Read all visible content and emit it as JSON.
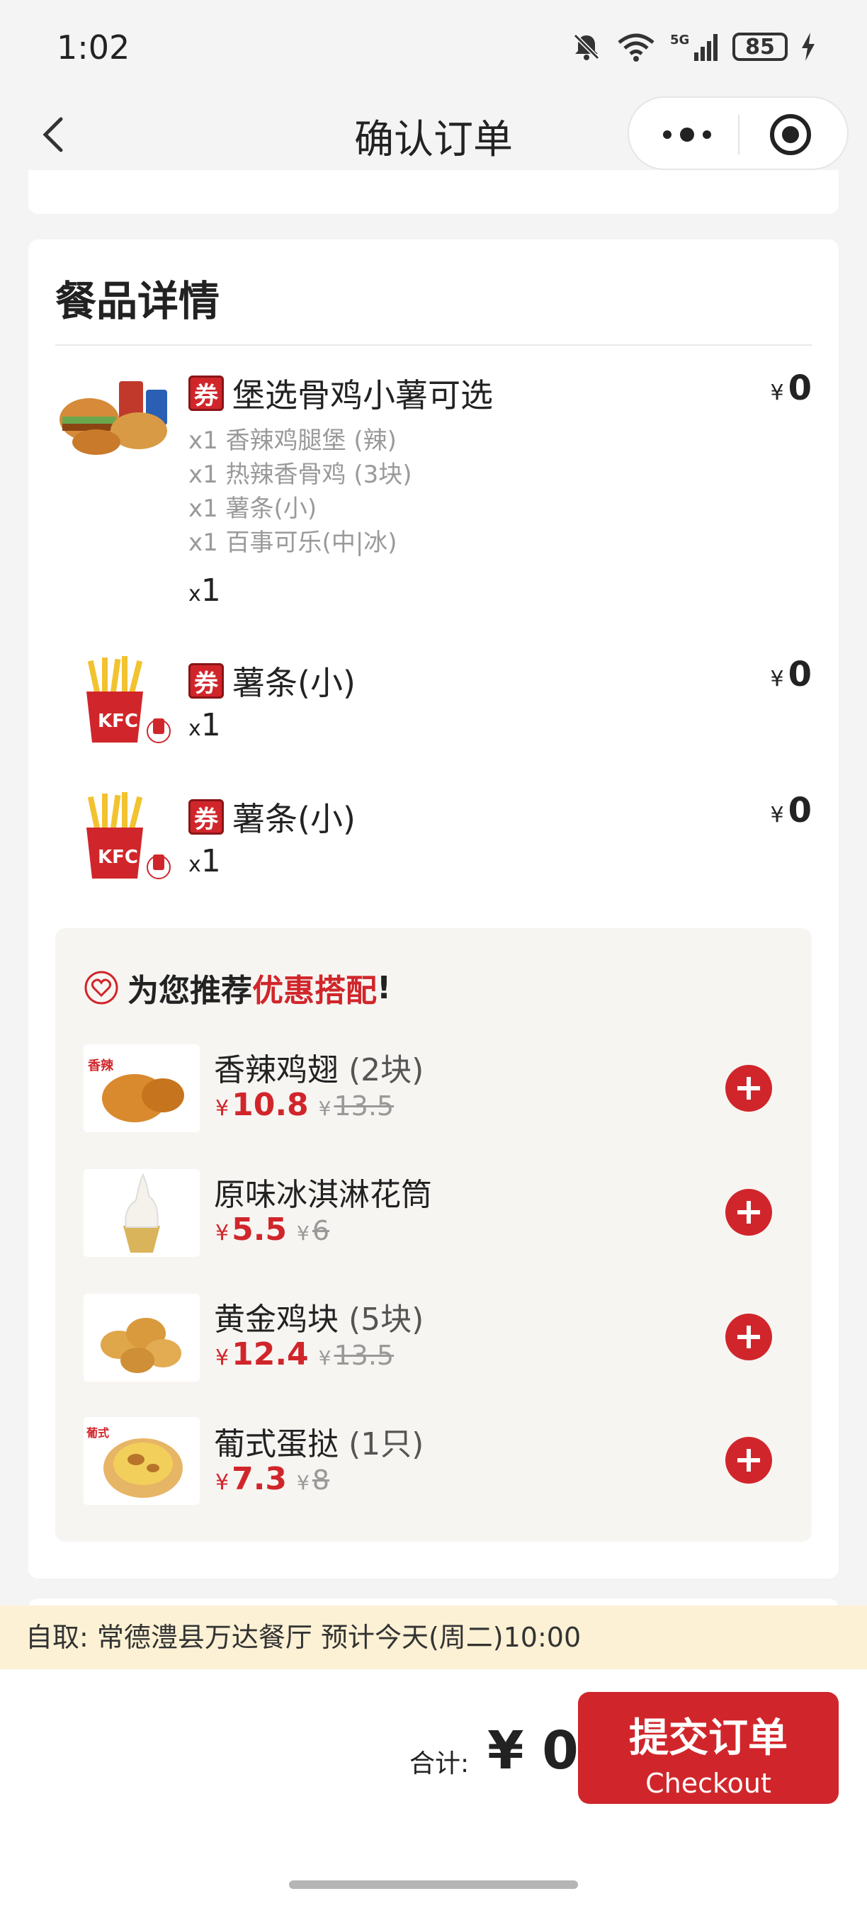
{
  "status_bar": {
    "time": "1:02",
    "battery": "85"
  },
  "nav": {
    "title": "确认订单"
  },
  "section": {
    "title": "餐品详情"
  },
  "items": [
    {
      "coupon": "券",
      "name": "堡选骨鸡小薯可选",
      "sub_items": [
        "x1 香辣鸡腿堡 (辣)",
        "x1 热辣香骨鸡 (3块)",
        "x1 薯条(小)",
        "x1 百事可乐(中|冰)"
      ],
      "qty_prefix": "x",
      "qty": "1",
      "currency": "¥",
      "price": "0"
    },
    {
      "coupon": "券",
      "name": "薯条(小)",
      "qty_prefix": "x",
      "qty": "1",
      "currency": "¥",
      "price": "0"
    },
    {
      "coupon": "券",
      "name": "薯条(小)",
      "qty_prefix": "x",
      "qty": "1",
      "currency": "¥",
      "price": "0"
    }
  ],
  "recommend": {
    "title_prefix": "为您推荐",
    "title_highlight": "优惠搭配",
    "title_suffix": "!",
    "items": [
      {
        "name": "香辣鸡翅",
        "spec": "(2块)",
        "currency": "¥",
        "price": "10.8",
        "orig_currency": "¥",
        "original_price": "13.5"
      },
      {
        "name": "原味冰淇淋花筒",
        "spec": "",
        "currency": "¥",
        "price": "5.5",
        "orig_currency": "¥",
        "original_price": "6"
      },
      {
        "name": "黄金鸡块",
        "spec": "(5块)",
        "currency": "¥",
        "price": "12.4",
        "orig_currency": "¥",
        "original_price": "13.5"
      },
      {
        "name": "葡式蛋挞",
        "spec": "(1只)",
        "currency": "¥",
        "price": "7.3",
        "orig_currency": "¥",
        "original_price": "8"
      }
    ]
  },
  "pickup": {
    "text": "自取: 常德澧县万达餐厅 预计今天(周二)10:00"
  },
  "footer": {
    "total_label": "合计:",
    "total_value": "¥ 0",
    "checkout_label": "提交订单",
    "checkout_sub": "Checkout"
  },
  "colors": {
    "accent": "#d0262b",
    "pickup_bg": "#fcf1d4",
    "page_bg": "#f4f4f4"
  }
}
